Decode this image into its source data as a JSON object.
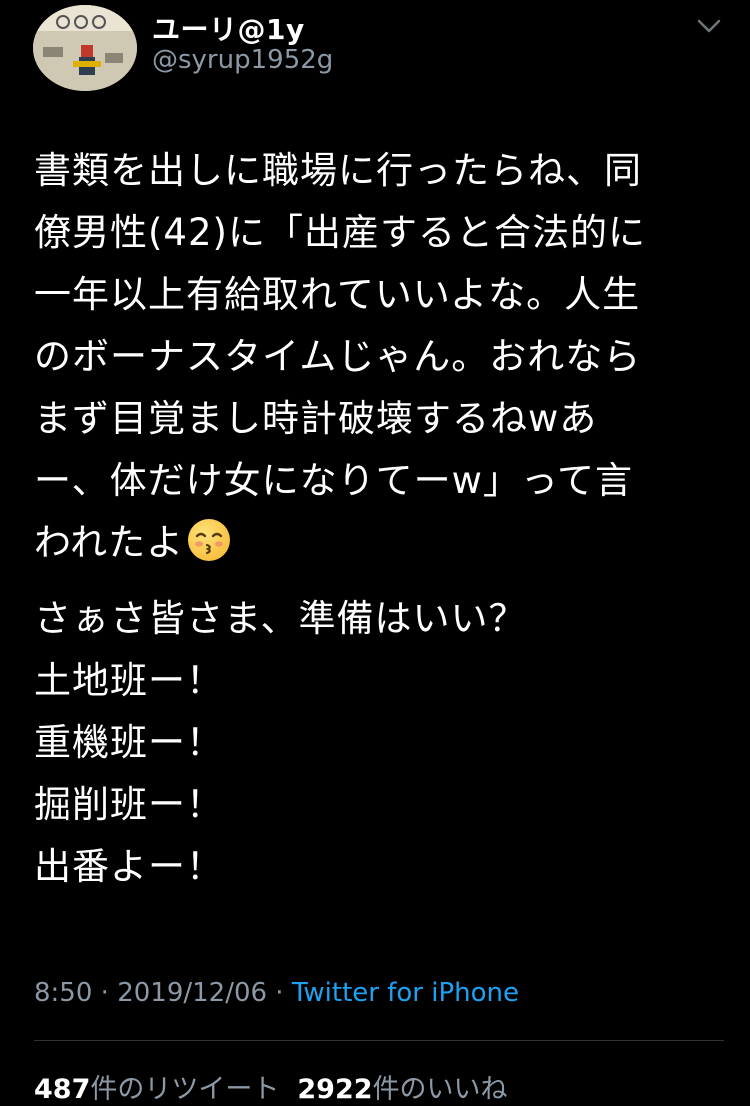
{
  "header": {
    "display_name": "ユーリ@1y",
    "handle": "@syrup1952g",
    "menu_icon": "chevron-down-icon"
  },
  "tweet": {
    "paragraph1": "書類を出しに職場に行ったらね、同\n僚男性(42)に「出産すると合法的に\n一年以上有給取れていいよな。人生\nのボーナスタイムじゃん。おれなら\nまず目覚まし時計破壊するねwあ\nー、体だけ女になりてーw」って言\nわれたよ",
    "emoji": "kissing-face-icon",
    "paragraph2": "さぁさ皆さま、準備はいい？\n土地班ー！\n重機班ー！\n掘削班ー！\n出番よー！"
  },
  "meta": {
    "time": "8:50",
    "separator": " · ",
    "date": "2019/12/06",
    "app": "Twitter for iPhone"
  },
  "stats": {
    "retweets_count": "487",
    "retweets_label": "件のリツイート",
    "likes_count": "2922",
    "likes_label": "件のいいね"
  }
}
